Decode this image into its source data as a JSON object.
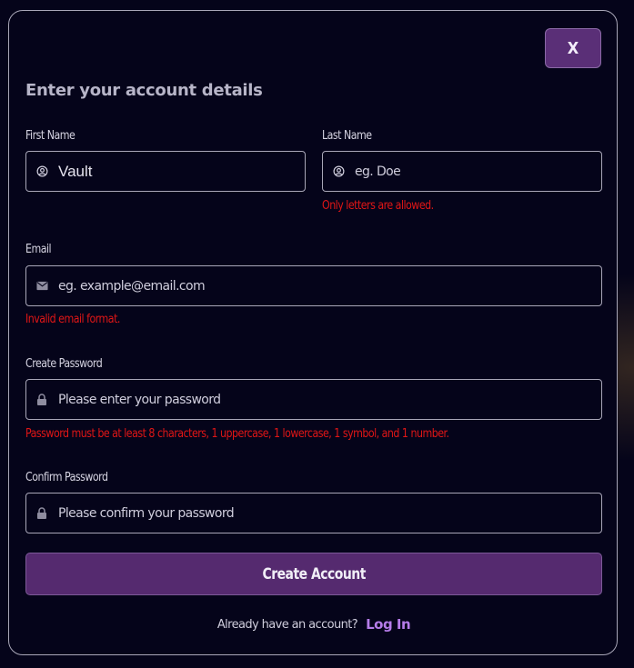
{
  "modal": {
    "close_label": "X",
    "title": "Enter your account details"
  },
  "form": {
    "first_name": {
      "label": "First Name",
      "value": "Vault",
      "placeholder": "",
      "icon": "user-circle-icon"
    },
    "last_name": {
      "label": "Last Name",
      "value": "",
      "placeholder": "eg. Doe",
      "icon": "user-circle-icon",
      "error": "Only letters are allowed."
    },
    "email": {
      "label": "Email",
      "value": "",
      "placeholder": "eg. example@email.com",
      "icon": "mail-icon",
      "error": "Invalid email format."
    },
    "password": {
      "label": "Create Password",
      "value": "",
      "placeholder": "Please enter your password",
      "icon": "lock-icon",
      "error": "Password must be at least 8 characters, 1 uppercase, 1 lowercase, 1 symbol, and 1 number."
    },
    "confirm_password": {
      "label": "Confirm Password",
      "value": "",
      "placeholder": "Please confirm your password",
      "icon": "lock-icon"
    },
    "submit_label": "Create Account"
  },
  "footer": {
    "prompt": "Already have an account?",
    "login_label": "Log In"
  },
  "colors": {
    "background": "#05041a",
    "accent": "#552a6f",
    "link": "#b57ce8",
    "error": "#e01616",
    "border": "#a9a7b8"
  }
}
